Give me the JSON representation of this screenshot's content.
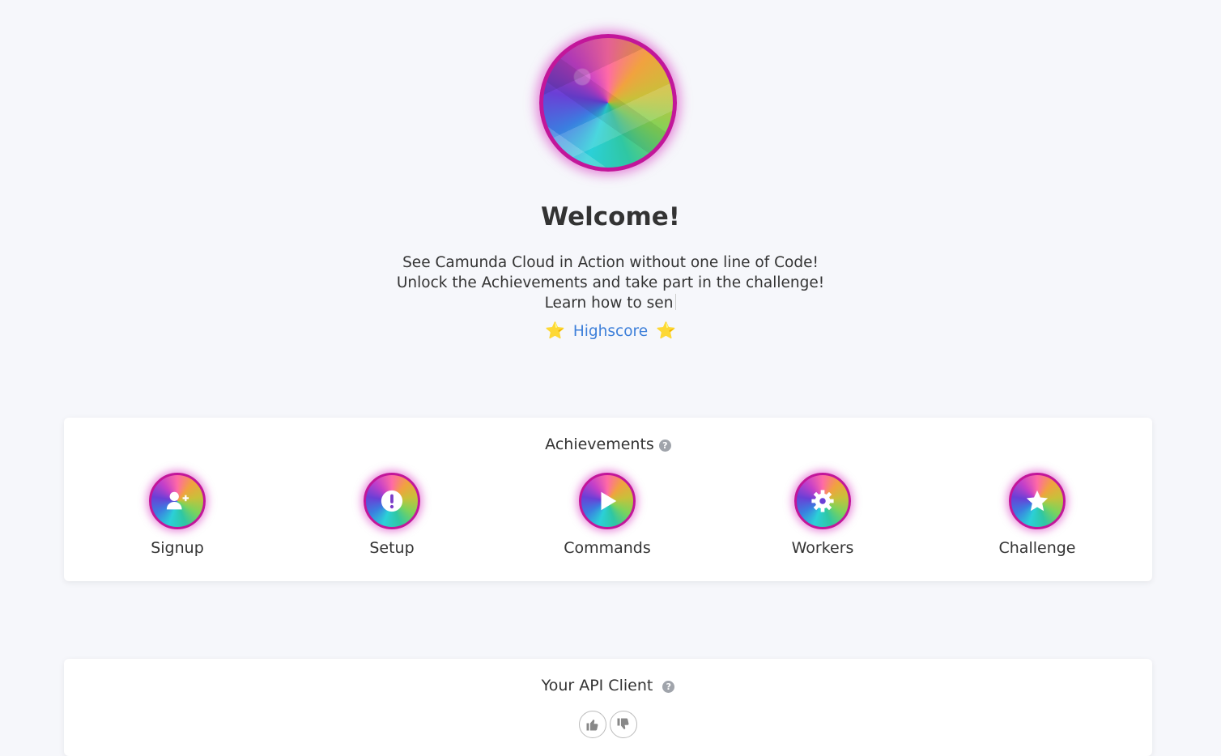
{
  "hero": {
    "title": "Welcome!",
    "intro_lines": [
      "See Camunda Cloud in Action without one line of Code!",
      "Unlock the Achievements and take part in the challenge!",
      "Learn how to sen"
    ],
    "highscore": {
      "star": "⭐",
      "label": "Highscore"
    }
  },
  "achievements": {
    "title": "Achievements",
    "help": "?",
    "items": [
      {
        "label": "Signup",
        "icon": "user-plus-icon"
      },
      {
        "label": "Setup",
        "icon": "exclamation-icon"
      },
      {
        "label": "Commands",
        "icon": "play-icon"
      },
      {
        "label": "Workers",
        "icon": "gear-icon"
      },
      {
        "label": "Challenge",
        "icon": "star-icon"
      }
    ]
  },
  "api_client": {
    "title": "Your API Client",
    "help": "?"
  },
  "colors": {
    "accent": "#c2169a",
    "link": "#3d7fd9",
    "background": "#f6f7fb"
  }
}
